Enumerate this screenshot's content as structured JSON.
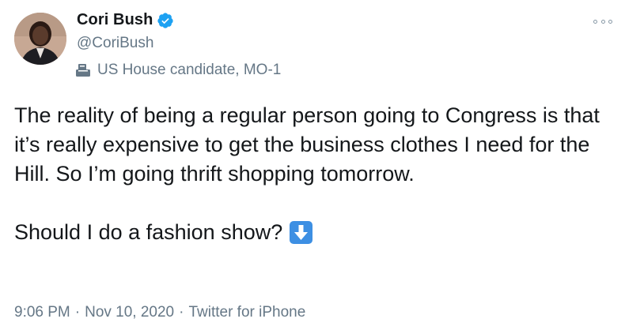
{
  "author": {
    "display_name": "Cori Bush",
    "handle": "@CoriBush",
    "verified": true,
    "label": "US House candidate, MO-1",
    "label_icon": "ballot-box-icon"
  },
  "tweet": {
    "paragraph_1": "The reality of being a regular person going to Congress is that it’s really expensive to get the business clothes I need for the Hill. So I’m going thrift shopping tomorrow.",
    "paragraph_2": "Should I do a fashion show?",
    "emoji_icon": "down-arrow-icon"
  },
  "meta": {
    "time": "9:06 PM",
    "separator": "·",
    "date": "Nov 10, 2020",
    "source": "Twitter for iPhone"
  },
  "colors": {
    "text_primary": "#14171a",
    "text_secondary": "#657786",
    "verified_blue": "#1da1f2",
    "emoji_blue": "#3d8fe3"
  },
  "icons": {
    "more": "more-options-icon",
    "verified": "verified-badge-icon"
  }
}
